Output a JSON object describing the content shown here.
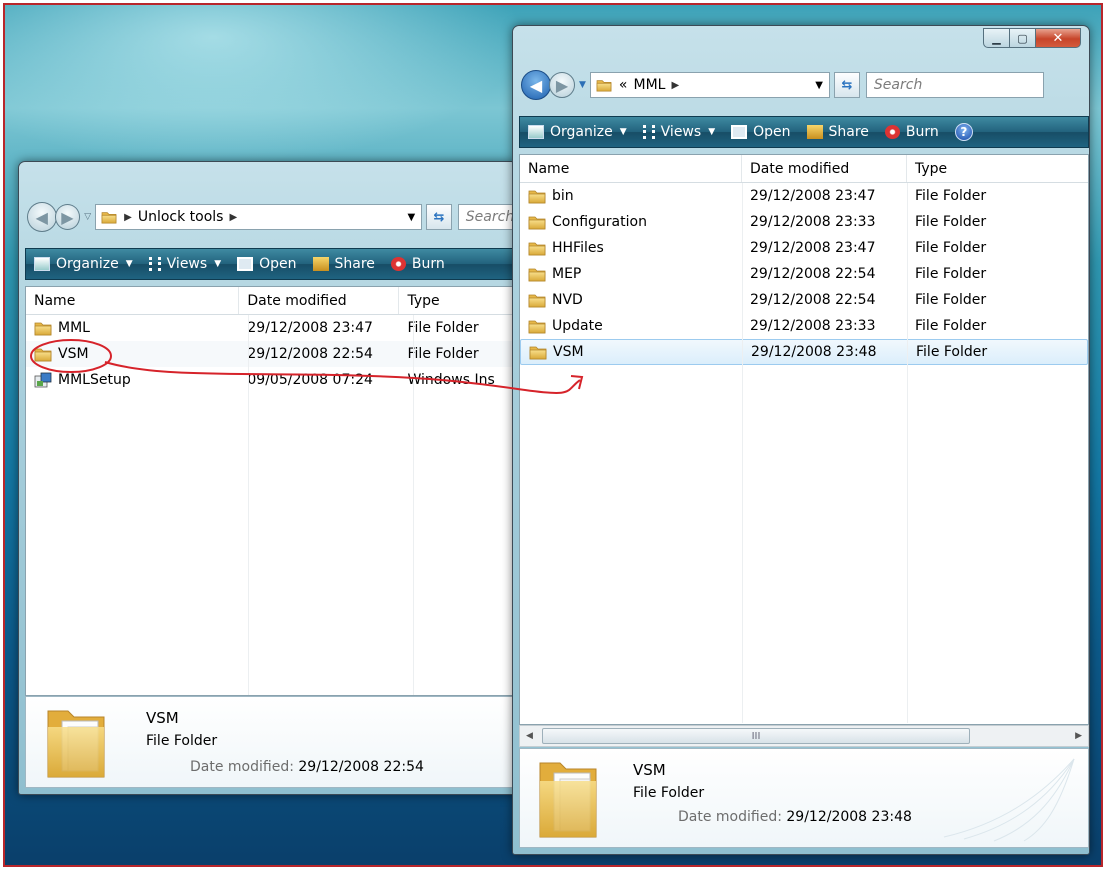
{
  "left_window": {
    "breadcrumb": "Unlock tools",
    "search_placeholder": "Search",
    "toolbar": {
      "organize": "Organize",
      "views": "Views",
      "open": "Open",
      "share": "Share",
      "burn": "Burn"
    },
    "columns": [
      "Name",
      "Date modified",
      "Type"
    ],
    "rows": [
      {
        "name": "MML",
        "date": "29/12/2008 23:47",
        "type": "File Folder",
        "icon": "folder-icon"
      },
      {
        "name": "VSM",
        "date": "29/12/2008 22:54",
        "type": "File Folder",
        "icon": "folder-icon"
      },
      {
        "name": "MMLSetup",
        "date": "09/05/2008 07:24",
        "type": "Windows Ins",
        "icon": "installer-icon"
      }
    ],
    "details": {
      "name": "VSM",
      "type": "File Folder",
      "date_label": "Date modified:",
      "date_value": "29/12/2008 22:54"
    }
  },
  "right_window": {
    "breadcrumb_prefix": "«",
    "breadcrumb": "MML",
    "search_placeholder": "Search",
    "toolbar": {
      "organize": "Organize",
      "views": "Views",
      "open": "Open",
      "share": "Share",
      "burn": "Burn",
      "help": "?"
    },
    "columns": [
      "Name",
      "Date modified",
      "Type"
    ],
    "rows": [
      {
        "name": "bin",
        "date": "29/12/2008 23:47",
        "type": "File Folder"
      },
      {
        "name": "Configuration",
        "date": "29/12/2008 23:33",
        "type": "File Folder"
      },
      {
        "name": "HHFiles",
        "date": "29/12/2008 23:47",
        "type": "File Folder"
      },
      {
        "name": "MEP",
        "date": "29/12/2008 22:54",
        "type": "File Folder"
      },
      {
        "name": "NVD",
        "date": "29/12/2008 22:54",
        "type": "File Folder"
      },
      {
        "name": "Update",
        "date": "29/12/2008 23:33",
        "type": "File Folder"
      },
      {
        "name": "VSM",
        "date": "29/12/2008 23:48",
        "type": "File Folder"
      }
    ],
    "scroll_grip": "III",
    "details": {
      "name": "VSM",
      "type": "File Folder",
      "date_label": "Date modified:",
      "date_value": "29/12/2008 23:48"
    }
  },
  "colors": {
    "selection": "#dbeefb",
    "annotation": "#d6232a",
    "toolbar": "#22627d"
  }
}
